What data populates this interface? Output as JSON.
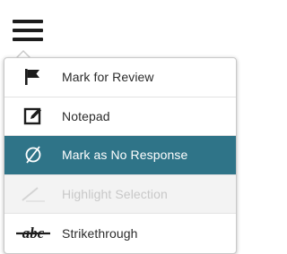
{
  "toolbar": {
    "menu_icon": "hamburger-menu-icon"
  },
  "menu": {
    "items": [
      {
        "label": "Mark for Review",
        "icon": "flag-icon",
        "state": "normal"
      },
      {
        "label": "Notepad",
        "icon": "notepad-icon",
        "state": "normal"
      },
      {
        "label": "Mark as No Response",
        "icon": "no-response-icon",
        "state": "selected"
      },
      {
        "label": "Highlight Selection",
        "icon": "highlighter-icon",
        "state": "disabled"
      },
      {
        "label": "Strikethrough",
        "icon": "strikethrough-icon",
        "icon_text": "abc",
        "state": "normal"
      }
    ]
  },
  "colors": {
    "selected_background": "#2f7488",
    "selected_text": "#ffffff",
    "disabled_background": "#f3f3f3",
    "disabled_text": "#c8c8c8",
    "text": "#2b2b2b",
    "icon": "#1c1c1c"
  }
}
